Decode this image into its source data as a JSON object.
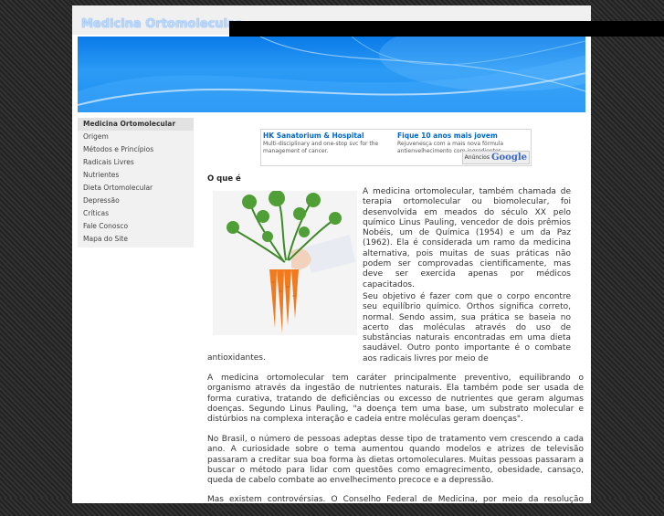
{
  "site": {
    "title": "Medicina Ortomolecular"
  },
  "sidebar": {
    "items": [
      {
        "label": "Medicina Ortomolecular"
      },
      {
        "label": "Origem"
      },
      {
        "label": "Métodos e Princípios"
      },
      {
        "label": "Radicais Livres"
      },
      {
        "label": "Nutrientes"
      },
      {
        "label": "Dieta Ortomolecular"
      },
      {
        "label": "Depressão"
      },
      {
        "label": "Críticas"
      },
      {
        "label": "Fale Conosco"
      },
      {
        "label": "Mapa do Site"
      }
    ]
  },
  "ads": {
    "ad1": {
      "title": "HK Sanatorium & Hospital",
      "text": "Multi-disciplinary and one-stop svc for the management of cancer."
    },
    "ad2": {
      "title": "Fique 10 anos mais jovem",
      "text": "Rejuvenesça com a mais nova fórmula antienvelhecimento com ingredientes"
    },
    "anuncios_label": "Anúncios",
    "google_label": "Google"
  },
  "content": {
    "heading": "O que é",
    "p1": "A medicina ortomolecular, também chamada de terapia ortomolecular ou biomolecular, foi desenvolvida em meados do século XX pelo químico Linus Pauling, vencedor de dois prêmios Nobéis, um de Química (1954) e um da Paz (1962). Ela é considerada um ramo da medicina alternativa, pois muitas de suas práticas não podem ser comprovadas cientificamente, mas deve ser exercida apenas por médicos capacitados.",
    "p2a": "Seu objetivo é fazer com que o corpo encontre seu equilíbrio químico. Orthos significa correto, normal. Sendo assim, sua prática se baseia no acerto das moléculas através do uso de substâncias naturais encontradas em uma dieta saudável. Outro ponto importante é o combate aos radicais livres por meio de",
    "p2b": "antioxidantes.",
    "p3": "A medicina ortomolecular tem caráter principalmente preventivo, equilibrando o organismo através da ingestão de nutrientes naturais. Ela também pode ser usada de forma curativa, tratando de deficiências ou excesso de nutrientes que geram algumas doenças. Segundo Linus Pauling, \"a doença tem uma base, um substrato molecular e distúrbios na complexa interação e cadeia entre moléculas geram doenças\".",
    "p4": "No Brasil, o número de pessoas adeptas desse tipo de tratamento vem crescendo a cada ano. A curiosidade sobre o tema aumentou quando modelos e atrizes de televisão passaram a creditar sua boa forma às dietas ortomoleculares. Muitas pessoas passaram a buscar o método para lidar com questões como emagrecimento, obesidade, cansaço, queda de cabelo combate ao envelhecimento precoce e a depressão.",
    "p5": "Mas existem controvérsias. O Conselho Federal de Medicina, por meio da resolução número"
  },
  "colors": {
    "banner_blue": "#1d8ef0",
    "title_text": "#b7d8ff",
    "ad_link": "#0066cc"
  }
}
